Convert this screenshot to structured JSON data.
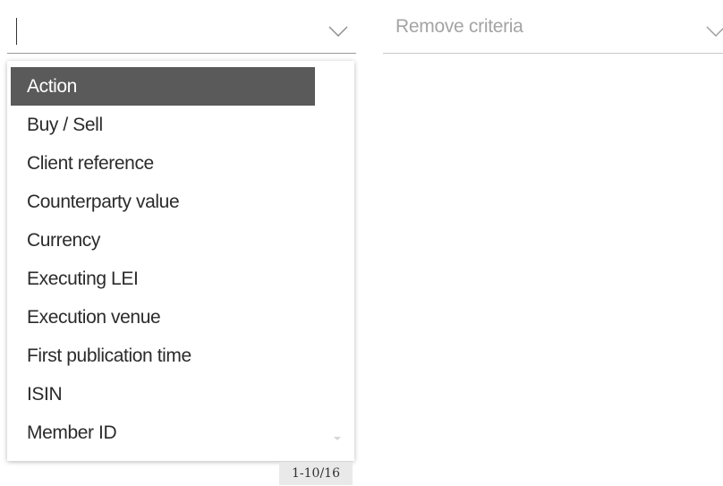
{
  "criteria_select": {
    "value": "",
    "icon": "chevron-down-icon"
  },
  "remove_select": {
    "placeholder": "Remove criteria",
    "icon": "chevron-down-icon"
  },
  "dropdown": {
    "options": [
      "Action",
      "Buy / Sell",
      "Client reference",
      "Counterparty value",
      "Currency",
      "Executing LEI",
      "Execution venue",
      "First publication time",
      "ISIN",
      "Member ID"
    ],
    "selected_index": 0,
    "pager": "1-10/16"
  },
  "colors": {
    "selected_bg": "#5a5a5a",
    "text": "#2b2b2b",
    "placeholder": "#a4a4a4"
  }
}
